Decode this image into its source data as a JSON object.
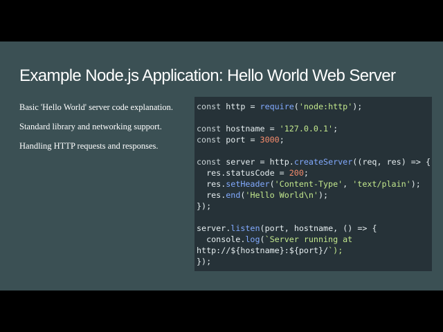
{
  "slide": {
    "title": "Example Node.js Application: Hello World Web Server",
    "bullets": [
      "Basic 'Hello World' server code explanation.",
      "Standard library and networking support.",
      "Handling HTTP requests and responses."
    ]
  },
  "code": {
    "lines": [
      "const http = require('node:http');",
      "",
      "const hostname = '127.0.0.1';",
      "const port = 3000;",
      "",
      "const server = http.createServer((req, res) => {",
      "  res.statusCode = 200;",
      "  res.setHeader('Content-Type', 'text/plain');",
      "  res.end('Hello World\\n');",
      "});",
      "",
      "server.listen(port, hostname, () => {",
      "  console.log(`Server running at",
      "http://${hostname}:${port}/`);",
      "});"
    ]
  },
  "colors": {
    "slide_background": "#3b5054",
    "letterbox": "#000000",
    "code_background": "#263238",
    "string": "#c3e88d",
    "number": "#f78c6c",
    "function": "#82aaff"
  }
}
